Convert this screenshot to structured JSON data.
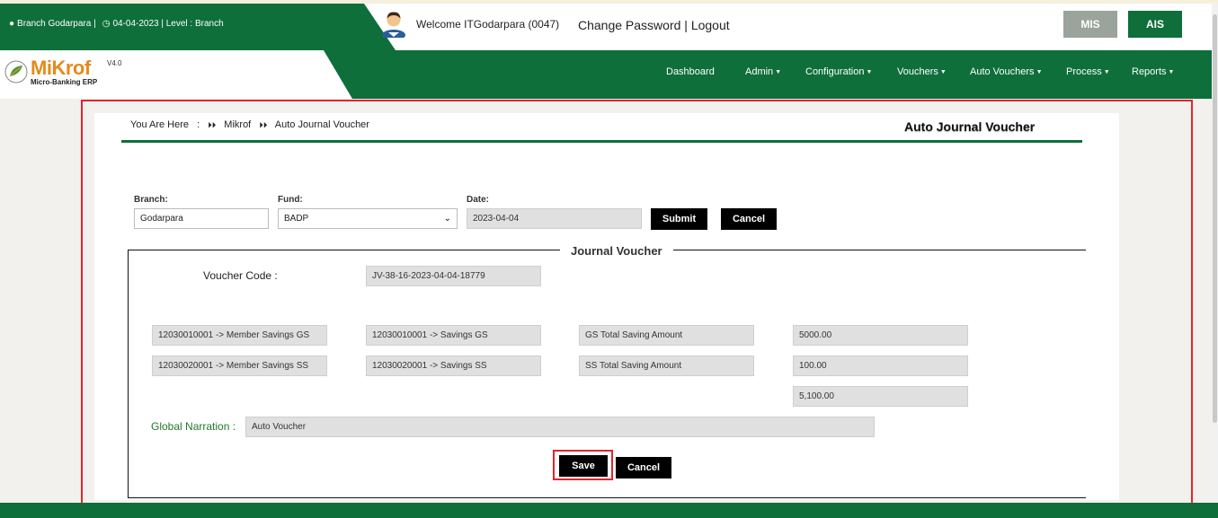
{
  "topbar": {
    "branch_text": "Branch Godarpara |",
    "date_level_text": "04-04-2023 | Level : Branch",
    "welcome": "Welcome ITGodarpara (0047)",
    "change_password": "Change Password",
    "separator": " | ",
    "logout": "Logout",
    "mis_label": "MIS",
    "ais_label": "AIS"
  },
  "logo": {
    "name": "MiKrof",
    "version": "V4.0",
    "subtitle": "Micro-Banking ERP"
  },
  "nav": {
    "items": [
      "Dashboard",
      "Admin",
      "Configuration",
      "Vouchers",
      "Auto Vouchers",
      "Process",
      "Reports"
    ]
  },
  "breadcrumb": {
    "prefix": "You Are Here",
    "colon": ":",
    "sep": "⏵⏵",
    "item1": "Mikrof",
    "item2": "Auto Journal Voucher"
  },
  "page_title": "Auto Journal Voucher",
  "filters": {
    "branch_label": "Branch:",
    "branch_value": "Godarpara",
    "fund_label": "Fund:",
    "fund_value": "BADP",
    "date_label": "Date:",
    "date_value": "2023-04-04",
    "submit_label": "Submit",
    "cancel_label": "Cancel"
  },
  "journal": {
    "legend": "Journal Voucher",
    "voucher_code_label": "Voucher Code :",
    "voucher_code": "JV-38-16-2023-04-04-18779",
    "rows": [
      {
        "account": "12030010001 -> Member Savings GS",
        "ledger": "12030010001  -> Savings GS",
        "description": "GS  Total Saving  Amount",
        "amount": "5000.00"
      },
      {
        "account": "12030020001 -> Member Savings SS",
        "ledger": "12030020001  -> Savings SS",
        "description": "SS  Total Saving  Amount",
        "amount": "100.00"
      }
    ],
    "total": "5,100.00",
    "narration_label": "Global Narration :",
    "narration_value": "Auto Voucher",
    "save_label": "Save",
    "cancel_label": "Cancel"
  },
  "colors": {
    "brand_green": "#0e6f3a",
    "logo_orange": "#e58a1a",
    "highlight_red": "#e0262b"
  }
}
